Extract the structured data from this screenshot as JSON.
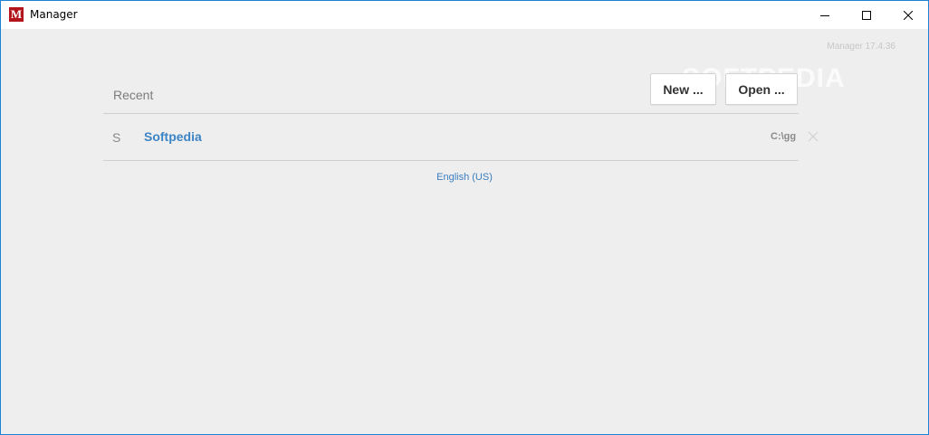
{
  "window": {
    "title": "Manager",
    "icon_letter": "M",
    "icon_color": "#b3131b"
  },
  "header": {
    "version": "Manager 17.4.36",
    "watermark": "SOFTPEDIA"
  },
  "recent": {
    "label": "Recent",
    "items": [
      {
        "letter": "S",
        "name": "Softpedia",
        "path": "C:\\gg"
      }
    ]
  },
  "buttons": {
    "new_label": "New ...",
    "open_label": "Open ..."
  },
  "footer": {
    "language": "English (US)"
  },
  "colors": {
    "accent": "#3b84c5",
    "background": "#eeeeee"
  }
}
